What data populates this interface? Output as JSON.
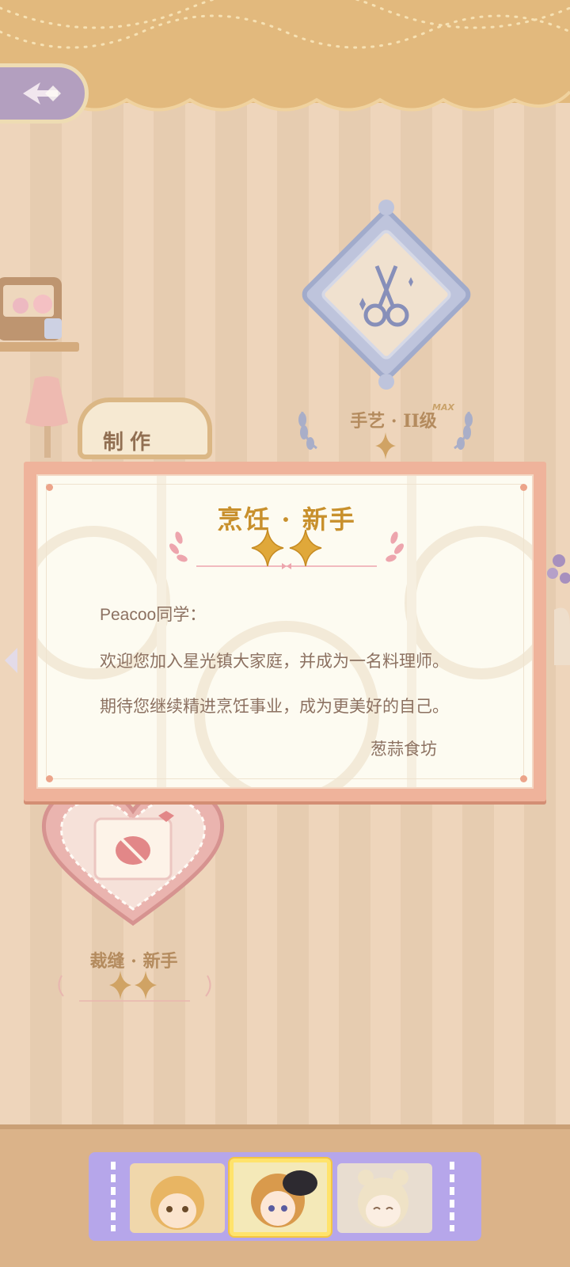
{
  "colors": {
    "modal_border": "#efb39b",
    "modal_paper": "#fdfbf1",
    "title_gold": "#c8902c",
    "letter_text": "#8c7161",
    "character_bar": "#b6a6ea",
    "selected_highlight": "#ffe36b"
  },
  "background": {
    "craft_skill": {
      "title": "手艺 · II级",
      "badge": "MAX",
      "icon": "scissors-icon",
      "stars": 1
    },
    "make_sign": {
      "label": "制作"
    },
    "sewing_skill": {
      "title": "裁缝 · 新手",
      "icon": "sewing-bag-icon",
      "stars": 2
    }
  },
  "modal": {
    "title": "烹饪 · 新手",
    "stars": 2,
    "greeting": "Peacoo同学：",
    "lines": [
      "欢迎您加入星光镇大家庭，并成为一名料理师。",
      "期待您继续精进烹饪事业，成为更美好的自己。"
    ],
    "signature": "葱蒜食坊"
  },
  "character_bar": {
    "characters": [
      {
        "name": "character-blonde-girl",
        "selected": false
      },
      {
        "name": "character-beret-girl",
        "selected": true
      },
      {
        "name": "character-bear-ears-girl",
        "selected": false
      }
    ]
  }
}
